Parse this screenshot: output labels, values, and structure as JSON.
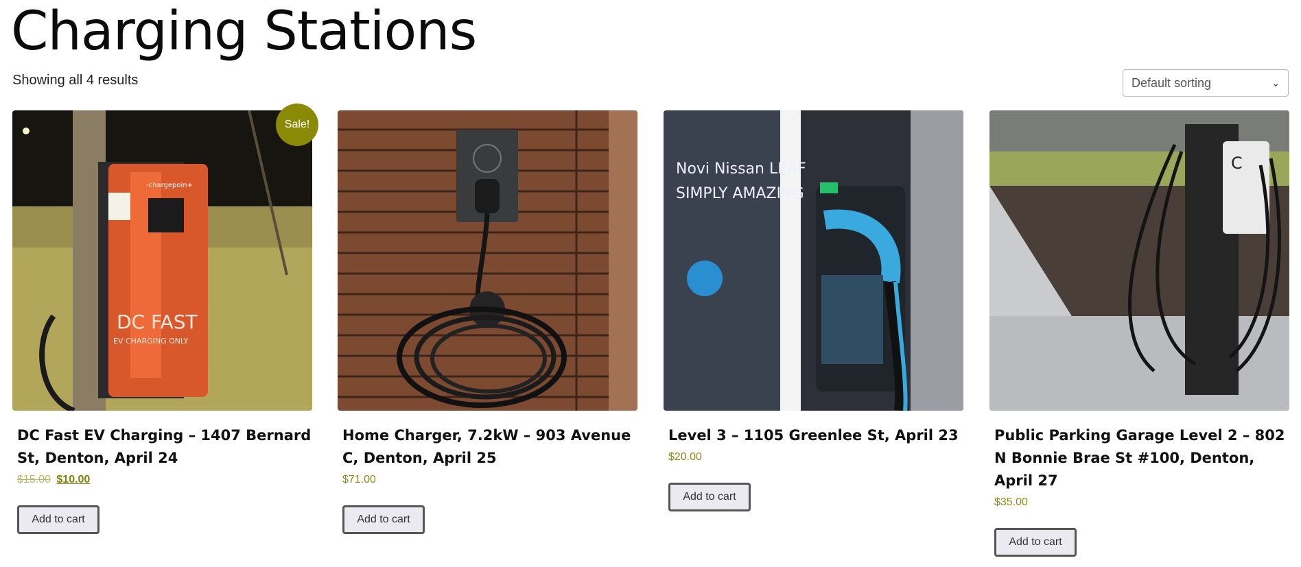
{
  "page": {
    "title": "Charging Stations",
    "result_count": "Showing all 4 results",
    "sort": {
      "selected": "Default sorting"
    }
  },
  "products": [
    {
      "image_icon": "charging-station-image",
      "badge": "Sale!",
      "title": "DC Fast EV Charging – 1407 Bernard St, Denton, April 24",
      "price_old": "$15.00",
      "price": "$10.00",
      "cart_label": "Add to cart",
      "image_text": {
        "brand": "-chargepoin+",
        "line1": "DC FAST",
        "line2": "EV CHARGING ONLY"
      }
    },
    {
      "image_icon": "wall-charger-image",
      "badge": "",
      "title": "Home Charger, 7.2kW – 903 Avenue C, Denton, April 25",
      "price_old": "",
      "price": "$71.00",
      "cart_label": "Add to cart"
    },
    {
      "image_icon": "nissan-charger-image",
      "badge": "",
      "title": "Level 3 – 1105 Greenlee St, April 23",
      "price_old": "",
      "price": "$20.00",
      "cart_label": "Add to cart",
      "image_text": {
        "line1": "Novi Nissan LEAF",
        "line2": "SIMPLY AMAZING"
      }
    },
    {
      "image_icon": "parking-garage-charger-image",
      "badge": "",
      "title": "Public Parking Garage Level 2 – 802 N Bonnie Brae St #100, Denton, April 27",
      "price_old": "",
      "price": "$35.00",
      "cart_label": "Add to cart"
    }
  ],
  "colors": {
    "accent": "#8a8a06",
    "price": "#8b8b16",
    "button_bg": "#eaeaf0",
    "button_border": "#555555"
  }
}
